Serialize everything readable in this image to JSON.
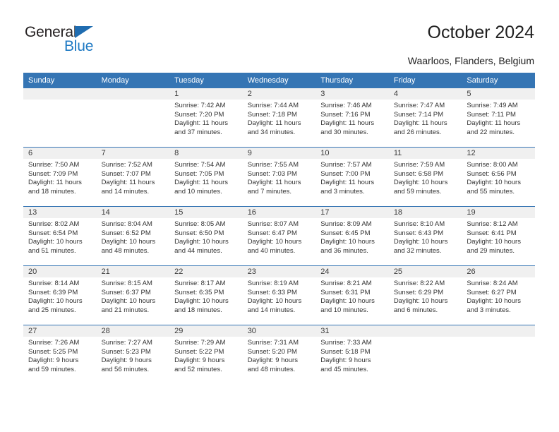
{
  "brand": {
    "name_top": "General",
    "name_bottom": "Blue",
    "accent_color": "#1f7ac4",
    "triangle_color": "#1f6cb0"
  },
  "header": {
    "title": "October 2024",
    "location": "Waarloos, Flanders, Belgium"
  },
  "theme": {
    "header_blue": "#3575b4",
    "daynum_band": "#f0f0f0",
    "text": "#333333"
  },
  "weekdays": [
    "Sunday",
    "Monday",
    "Tuesday",
    "Wednesday",
    "Thursday",
    "Friday",
    "Saturday"
  ],
  "weeks": [
    [
      {
        "empty": true
      },
      {
        "empty": true
      },
      {
        "day": "1",
        "sunrise": "Sunrise: 7:42 AM",
        "sunset": "Sunset: 7:20 PM",
        "daylight1": "Daylight: 11 hours",
        "daylight2": "and 37 minutes."
      },
      {
        "day": "2",
        "sunrise": "Sunrise: 7:44 AM",
        "sunset": "Sunset: 7:18 PM",
        "daylight1": "Daylight: 11 hours",
        "daylight2": "and 34 minutes."
      },
      {
        "day": "3",
        "sunrise": "Sunrise: 7:46 AM",
        "sunset": "Sunset: 7:16 PM",
        "daylight1": "Daylight: 11 hours",
        "daylight2": "and 30 minutes."
      },
      {
        "day": "4",
        "sunrise": "Sunrise: 7:47 AM",
        "sunset": "Sunset: 7:14 PM",
        "daylight1": "Daylight: 11 hours",
        "daylight2": "and 26 minutes."
      },
      {
        "day": "5",
        "sunrise": "Sunrise: 7:49 AM",
        "sunset": "Sunset: 7:11 PM",
        "daylight1": "Daylight: 11 hours",
        "daylight2": "and 22 minutes."
      }
    ],
    [
      {
        "day": "6",
        "sunrise": "Sunrise: 7:50 AM",
        "sunset": "Sunset: 7:09 PM",
        "daylight1": "Daylight: 11 hours",
        "daylight2": "and 18 minutes."
      },
      {
        "day": "7",
        "sunrise": "Sunrise: 7:52 AM",
        "sunset": "Sunset: 7:07 PM",
        "daylight1": "Daylight: 11 hours",
        "daylight2": "and 14 minutes."
      },
      {
        "day": "8",
        "sunrise": "Sunrise: 7:54 AM",
        "sunset": "Sunset: 7:05 PM",
        "daylight1": "Daylight: 11 hours",
        "daylight2": "and 10 minutes."
      },
      {
        "day": "9",
        "sunrise": "Sunrise: 7:55 AM",
        "sunset": "Sunset: 7:03 PM",
        "daylight1": "Daylight: 11 hours",
        "daylight2": "and 7 minutes."
      },
      {
        "day": "10",
        "sunrise": "Sunrise: 7:57 AM",
        "sunset": "Sunset: 7:00 PM",
        "daylight1": "Daylight: 11 hours",
        "daylight2": "and 3 minutes."
      },
      {
        "day": "11",
        "sunrise": "Sunrise: 7:59 AM",
        "sunset": "Sunset: 6:58 PM",
        "daylight1": "Daylight: 10 hours",
        "daylight2": "and 59 minutes."
      },
      {
        "day": "12",
        "sunrise": "Sunrise: 8:00 AM",
        "sunset": "Sunset: 6:56 PM",
        "daylight1": "Daylight: 10 hours",
        "daylight2": "and 55 minutes."
      }
    ],
    [
      {
        "day": "13",
        "sunrise": "Sunrise: 8:02 AM",
        "sunset": "Sunset: 6:54 PM",
        "daylight1": "Daylight: 10 hours",
        "daylight2": "and 51 minutes."
      },
      {
        "day": "14",
        "sunrise": "Sunrise: 8:04 AM",
        "sunset": "Sunset: 6:52 PM",
        "daylight1": "Daylight: 10 hours",
        "daylight2": "and 48 minutes."
      },
      {
        "day": "15",
        "sunrise": "Sunrise: 8:05 AM",
        "sunset": "Sunset: 6:50 PM",
        "daylight1": "Daylight: 10 hours",
        "daylight2": "and 44 minutes."
      },
      {
        "day": "16",
        "sunrise": "Sunrise: 8:07 AM",
        "sunset": "Sunset: 6:47 PM",
        "daylight1": "Daylight: 10 hours",
        "daylight2": "and 40 minutes."
      },
      {
        "day": "17",
        "sunrise": "Sunrise: 8:09 AM",
        "sunset": "Sunset: 6:45 PM",
        "daylight1": "Daylight: 10 hours",
        "daylight2": "and 36 minutes."
      },
      {
        "day": "18",
        "sunrise": "Sunrise: 8:10 AM",
        "sunset": "Sunset: 6:43 PM",
        "daylight1": "Daylight: 10 hours",
        "daylight2": "and 32 minutes."
      },
      {
        "day": "19",
        "sunrise": "Sunrise: 8:12 AM",
        "sunset": "Sunset: 6:41 PM",
        "daylight1": "Daylight: 10 hours",
        "daylight2": "and 29 minutes."
      }
    ],
    [
      {
        "day": "20",
        "sunrise": "Sunrise: 8:14 AM",
        "sunset": "Sunset: 6:39 PM",
        "daylight1": "Daylight: 10 hours",
        "daylight2": "and 25 minutes."
      },
      {
        "day": "21",
        "sunrise": "Sunrise: 8:15 AM",
        "sunset": "Sunset: 6:37 PM",
        "daylight1": "Daylight: 10 hours",
        "daylight2": "and 21 minutes."
      },
      {
        "day": "22",
        "sunrise": "Sunrise: 8:17 AM",
        "sunset": "Sunset: 6:35 PM",
        "daylight1": "Daylight: 10 hours",
        "daylight2": "and 18 minutes."
      },
      {
        "day": "23",
        "sunrise": "Sunrise: 8:19 AM",
        "sunset": "Sunset: 6:33 PM",
        "daylight1": "Daylight: 10 hours",
        "daylight2": "and 14 minutes."
      },
      {
        "day": "24",
        "sunrise": "Sunrise: 8:21 AM",
        "sunset": "Sunset: 6:31 PM",
        "daylight1": "Daylight: 10 hours",
        "daylight2": "and 10 minutes."
      },
      {
        "day": "25",
        "sunrise": "Sunrise: 8:22 AM",
        "sunset": "Sunset: 6:29 PM",
        "daylight1": "Daylight: 10 hours",
        "daylight2": "and 6 minutes."
      },
      {
        "day": "26",
        "sunrise": "Sunrise: 8:24 AM",
        "sunset": "Sunset: 6:27 PM",
        "daylight1": "Daylight: 10 hours",
        "daylight2": "and 3 minutes."
      }
    ],
    [
      {
        "day": "27",
        "sunrise": "Sunrise: 7:26 AM",
        "sunset": "Sunset: 5:25 PM",
        "daylight1": "Daylight: 9 hours",
        "daylight2": "and 59 minutes."
      },
      {
        "day": "28",
        "sunrise": "Sunrise: 7:27 AM",
        "sunset": "Sunset: 5:23 PM",
        "daylight1": "Daylight: 9 hours",
        "daylight2": "and 56 minutes."
      },
      {
        "day": "29",
        "sunrise": "Sunrise: 7:29 AM",
        "sunset": "Sunset: 5:22 PM",
        "daylight1": "Daylight: 9 hours",
        "daylight2": "and 52 minutes."
      },
      {
        "day": "30",
        "sunrise": "Sunrise: 7:31 AM",
        "sunset": "Sunset: 5:20 PM",
        "daylight1": "Daylight: 9 hours",
        "daylight2": "and 48 minutes."
      },
      {
        "day": "31",
        "sunrise": "Sunrise: 7:33 AM",
        "sunset": "Sunset: 5:18 PM",
        "daylight1": "Daylight: 9 hours",
        "daylight2": "and 45 minutes."
      },
      {
        "empty": true
      },
      {
        "empty": true
      }
    ]
  ]
}
